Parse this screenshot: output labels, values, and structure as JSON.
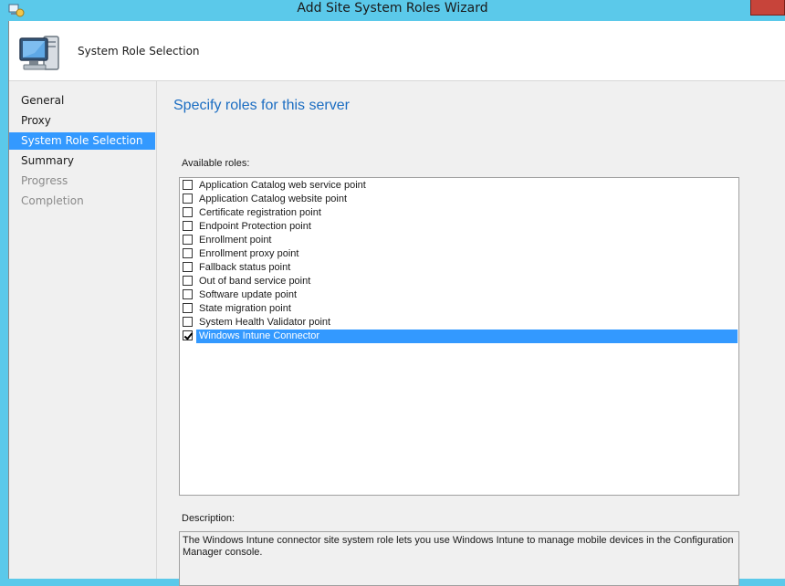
{
  "window": {
    "title": "Add Site System Roles Wizard"
  },
  "header": {
    "title": "System Role Selection",
    "icon": "computer-icon"
  },
  "nav": {
    "items": [
      {
        "label": "General",
        "state": "normal"
      },
      {
        "label": "Proxy",
        "state": "normal"
      },
      {
        "label": "System Role Selection",
        "state": "selected"
      },
      {
        "label": "Summary",
        "state": "normal"
      },
      {
        "label": "Progress",
        "state": "disabled"
      },
      {
        "label": "Completion",
        "state": "disabled"
      }
    ]
  },
  "main": {
    "heading": "Specify roles for this server",
    "roles_label": "Available roles:",
    "roles": [
      {
        "label": "Application Catalog web service point",
        "checked": false
      },
      {
        "label": "Application Catalog website point",
        "checked": false
      },
      {
        "label": "Certificate registration point",
        "checked": false
      },
      {
        "label": "Endpoint Protection point",
        "checked": false
      },
      {
        "label": "Enrollment point",
        "checked": false
      },
      {
        "label": "Enrollment proxy point",
        "checked": false
      },
      {
        "label": "Fallback status point",
        "checked": false
      },
      {
        "label": "Out of band service point",
        "checked": false
      },
      {
        "label": "Software update point",
        "checked": false
      },
      {
        "label": "State migration point",
        "checked": false
      },
      {
        "label": "System Health Validator point",
        "checked": false
      },
      {
        "label": "Windows Intune Connector",
        "checked": true,
        "selected": true
      }
    ],
    "description_label": "Description:",
    "description": "The Windows Intune connector site system role lets you use Windows Intune to manage mobile devices in the Configuration Manager console."
  },
  "colors": {
    "accent": "#3399ff",
    "heading": "#1b6dc2",
    "titlebar": "#5bc9ea",
    "close": "#c7443a"
  }
}
